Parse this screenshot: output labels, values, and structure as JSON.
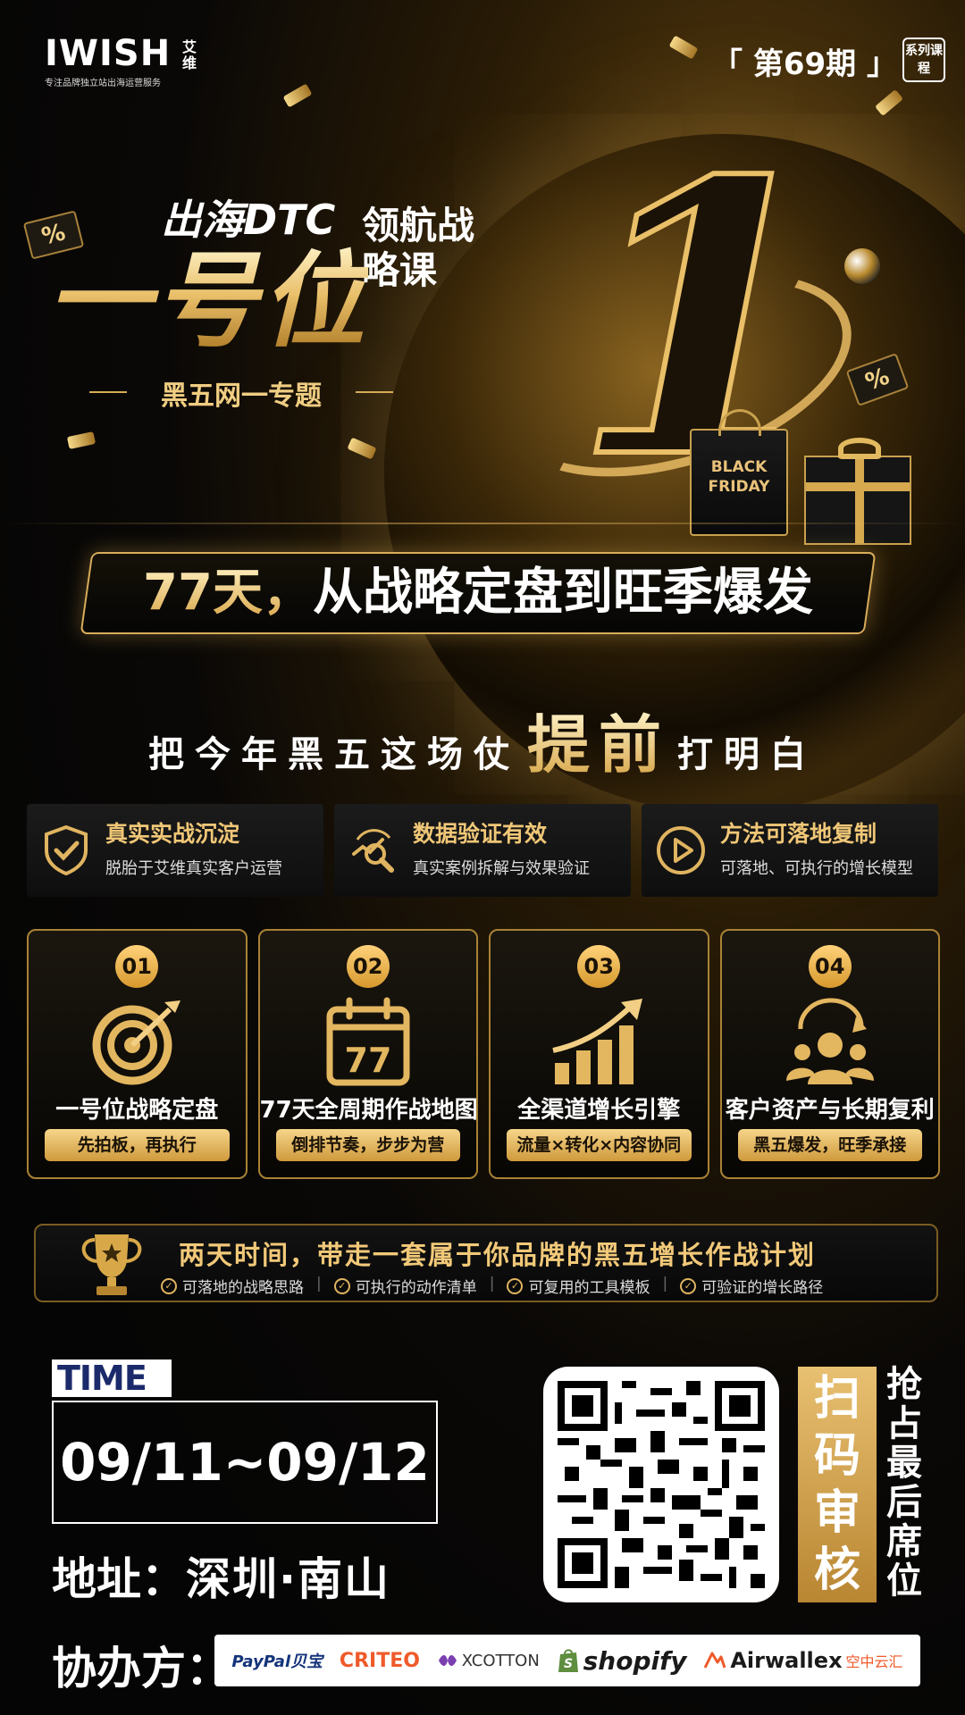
{
  "header": {
    "logo_text": "IWISH",
    "logo_cn": "艾维",
    "logo_tagline": "专注品牌独立站出海运营服务",
    "issue": "「 第69期 」",
    "series_badge": "系列课程"
  },
  "hero": {
    "title_dtc": "出海DTC",
    "title_lead": "领航战略课",
    "title_main": "一号位",
    "subtitle": "黑五网一专题",
    "big_number": "1",
    "bag_text": "BLACK FRIDAY",
    "ticket_symbol": "%"
  },
  "banner": {
    "highlight": "77天，",
    "rest": "从战略定盘到旺季爆发"
  },
  "slogan": {
    "part1": "把今年黑五这场仗",
    "emphasis": "提前",
    "part2": "打明白"
  },
  "features": [
    {
      "icon": "shield-check-icon",
      "title": "真实实战沉淀",
      "desc": "脱胎于艾维真实客户运营"
    },
    {
      "icon": "chart-magnifier-icon",
      "title": "数据验证有效",
      "desc": "真实案例拆解与效果验证"
    },
    {
      "icon": "play-circle-icon",
      "title": "方法可落地复制",
      "desc": "可落地、可执行的增长模型"
    }
  ],
  "cards": [
    {
      "num": "01",
      "icon": "target-icon",
      "title": "一号位战略定盘",
      "tag": "先拍板，再执行"
    },
    {
      "num": "02",
      "icon": "calendar-icon",
      "calendar_text": "77",
      "title": "77天全周期作战地图",
      "tag": "倒排节奏，步步为营"
    },
    {
      "num": "03",
      "icon": "growth-chart-icon",
      "title": "全渠道增长引擎",
      "tag": "流量×转化×内容协同"
    },
    {
      "num": "04",
      "icon": "customers-icon",
      "title": "客户资产与长期复利",
      "tag": "黑五爆发，旺季承接"
    }
  ],
  "takeaway": {
    "title": "两天时间，带走一套属于你品牌的黑五增长作战计划",
    "items": [
      "可落地的战略思路",
      "可执行的动作清单",
      "可复用的工具模板",
      "可验证的增长路径"
    ]
  },
  "event": {
    "time_label": "TIME",
    "time_value": "09/11~09/12",
    "address_label": "地址：",
    "address_value": "深圳·南山"
  },
  "cta": {
    "scan_text": "扫码审核",
    "grab_text": "抢占最后席位"
  },
  "sponsors": {
    "label": "协办方：",
    "items": [
      "PayPal贝宝",
      "CRITEO",
      "XCOTTON",
      "shopify",
      "Airwallex",
      "空中云汇"
    ]
  },
  "colors": {
    "gold": "#e0b460",
    "gold_light": "#f6d58a",
    "background": "#050505",
    "time_label_text": "#1b2a6b",
    "criteo": "#ef5a2a"
  }
}
